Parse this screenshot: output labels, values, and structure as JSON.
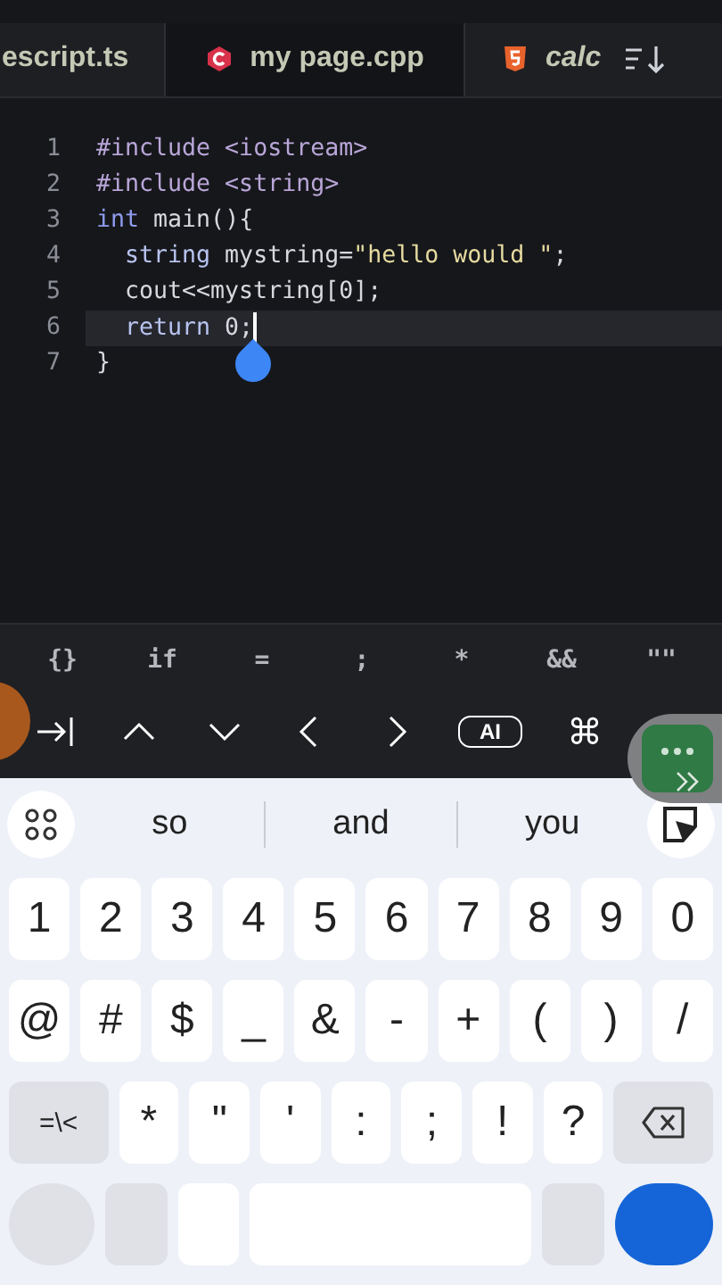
{
  "tabs": [
    {
      "label": "escript.ts",
      "kind": "plain",
      "selected": false,
      "preview": false
    },
    {
      "label": "my page.cpp",
      "kind": "cpp",
      "selected": true,
      "preview": false
    },
    {
      "label": "calc",
      "kind": "html",
      "selected": false,
      "preview": true
    }
  ],
  "editor": {
    "lines": [
      {
        "number": "1",
        "current": false,
        "tokens": [
          {
            "text": "#include",
            "kind": "directive"
          },
          {
            "text": " <iostream>",
            "kind": "header"
          }
        ]
      },
      {
        "number": "2",
        "current": false,
        "tokens": [
          {
            "text": "#include",
            "kind": "directive"
          },
          {
            "text": " <string>",
            "kind": "header"
          }
        ]
      },
      {
        "number": "3",
        "current": false,
        "tokens": [
          {
            "text": "int",
            "kind": "type"
          },
          {
            "text": " main(){",
            "kind": "plain"
          }
        ]
      },
      {
        "number": "4",
        "current": false,
        "tokens": [
          {
            "text": "  string",
            "kind": "ident"
          },
          {
            "text": " mystring=",
            "kind": "plain"
          },
          {
            "text": "\"hello would \"",
            "kind": "string"
          },
          {
            "text": ";",
            "kind": "plain"
          }
        ]
      },
      {
        "number": "5",
        "current": false,
        "tokens": [
          {
            "text": "  cout<<mystring[0];",
            "kind": "plain"
          }
        ]
      },
      {
        "number": "6",
        "current": true,
        "tokens": [
          {
            "text": "  return",
            "kind": "ident"
          },
          {
            "text": " 0;",
            "kind": "plain"
          }
        ]
      },
      {
        "number": "7",
        "current": false,
        "tokens": [
          {
            "text": "}",
            "kind": "plain"
          }
        ]
      }
    ]
  },
  "snippets": [
    "{}",
    "if",
    "=",
    ";",
    "*",
    "&&",
    "\"\""
  ],
  "nav_keys": [
    {
      "kind": "tab"
    },
    {
      "kind": "up"
    },
    {
      "kind": "down"
    },
    {
      "kind": "left"
    },
    {
      "kind": "right"
    },
    {
      "kind": "ai",
      "label": "AI"
    },
    {
      "kind": "text",
      "label": "⌘"
    }
  ],
  "suggestions": [
    "so",
    "and",
    "you"
  ],
  "keyboard": [
    [
      {
        "kind": "char",
        "label": "1"
      },
      {
        "kind": "char",
        "label": "2"
      },
      {
        "kind": "char",
        "label": "3"
      },
      {
        "kind": "char",
        "label": "4"
      },
      {
        "kind": "char",
        "label": "5"
      },
      {
        "kind": "char",
        "label": "6"
      },
      {
        "kind": "char",
        "label": "7"
      },
      {
        "kind": "char",
        "label": "8"
      },
      {
        "kind": "char",
        "label": "9"
      },
      {
        "kind": "char",
        "label": "0"
      }
    ],
    [
      {
        "kind": "char",
        "label": "@"
      },
      {
        "kind": "char",
        "label": "#"
      },
      {
        "kind": "char",
        "label": "$"
      },
      {
        "kind": "char",
        "label": "_"
      },
      {
        "kind": "char",
        "label": "&"
      },
      {
        "kind": "char",
        "label": "-"
      },
      {
        "kind": "char",
        "label": "+"
      },
      {
        "kind": "char",
        "label": "("
      },
      {
        "kind": "char",
        "label": ")"
      },
      {
        "kind": "char",
        "label": "/"
      }
    ],
    [
      {
        "kind": "function",
        "label": "=\\<"
      },
      {
        "kind": "char",
        "label": "*"
      },
      {
        "kind": "char",
        "label": "\""
      },
      {
        "kind": "char",
        "label": "'"
      },
      {
        "kind": "char",
        "label": ":"
      },
      {
        "kind": "char",
        "label": ";"
      },
      {
        "kind": "char",
        "label": "!"
      },
      {
        "kind": "char",
        "label": "?"
      },
      {
        "kind": "backspace"
      }
    ],
    [
      {
        "kind": "function_wide"
      },
      {
        "kind": "function"
      },
      {
        "kind": "char"
      },
      {
        "kind": "space"
      },
      {
        "kind": "function"
      },
      {
        "kind": "enter"
      }
    ]
  ]
}
